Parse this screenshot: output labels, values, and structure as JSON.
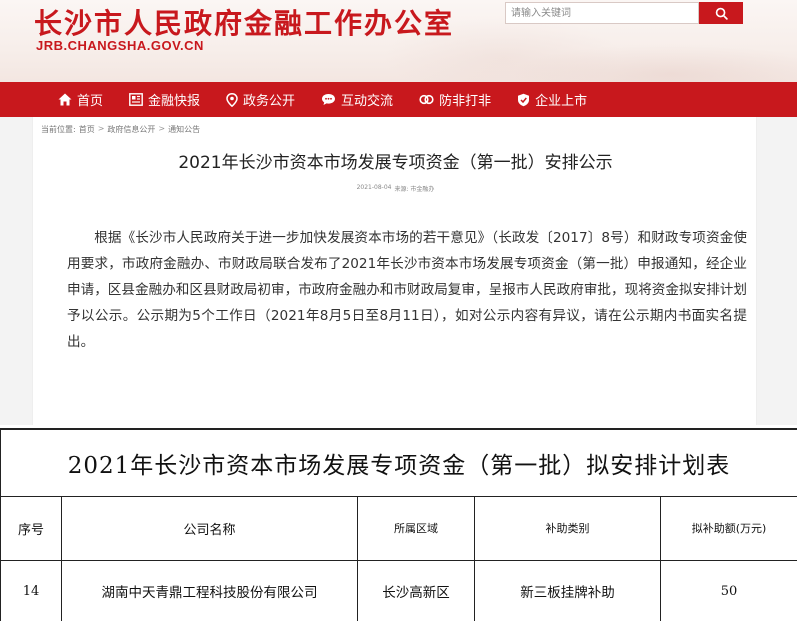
{
  "header": {
    "site_title": "长沙市人民政府金融工作办公室",
    "site_url": "JRB.CHANGSHA.GOV.CN",
    "search_placeholder": "请输入关键词"
  },
  "nav": {
    "items": [
      {
        "label": "首页",
        "icon": "home-icon"
      },
      {
        "label": "金融快报",
        "icon": "news-icon"
      },
      {
        "label": "政务公开",
        "icon": "location-icon"
      },
      {
        "label": "互动交流",
        "icon": "chat-icon"
      },
      {
        "label": "防非打非",
        "icon": "link-icon"
      },
      {
        "label": "企业上市",
        "icon": "shield-icon"
      }
    ]
  },
  "breadcrumb": {
    "prefix": "当前位置:",
    "items": [
      "首页",
      "政府信息公开",
      "通知公告"
    ],
    "sep": ">"
  },
  "article": {
    "title": "2021年长沙市资本市场发展专项资金（第一批）安排公示",
    "date": "2021-08-04",
    "source": "来源: 市金融办",
    "body": "根据《长沙市人民政府关于进一步加快发展资本市场的若干意见》（长政发〔2017〕8号）和财政专项资金使用要求，市政府金融办、市财政局联合发布了2021年长沙市资本市场发展专项资金（第一批）申报通知，经企业申请，区县金融办和区县财政局初审，市政府金融办和市财政局复审，呈报市人民政府审批，现将资金拟安排计划予以公示。公示期为5个工作日（2021年8月5日至8月11日），如对公示内容有异议，请在公示期内书面实名提出。"
  },
  "plan_table": {
    "title": "2021年长沙市资本市场发展专项资金（第一批）拟安排计划表",
    "headers": [
      "序号",
      "公司名称",
      "所属区域",
      "补助类别",
      "拟补助额(万元)"
    ],
    "rows": [
      [
        "14",
        "湖南中天青鼎工程科技股份有限公司",
        "长沙高新区",
        "新三板挂牌补助",
        "50"
      ]
    ]
  },
  "colors": {
    "brand_red": "#c8181d"
  }
}
